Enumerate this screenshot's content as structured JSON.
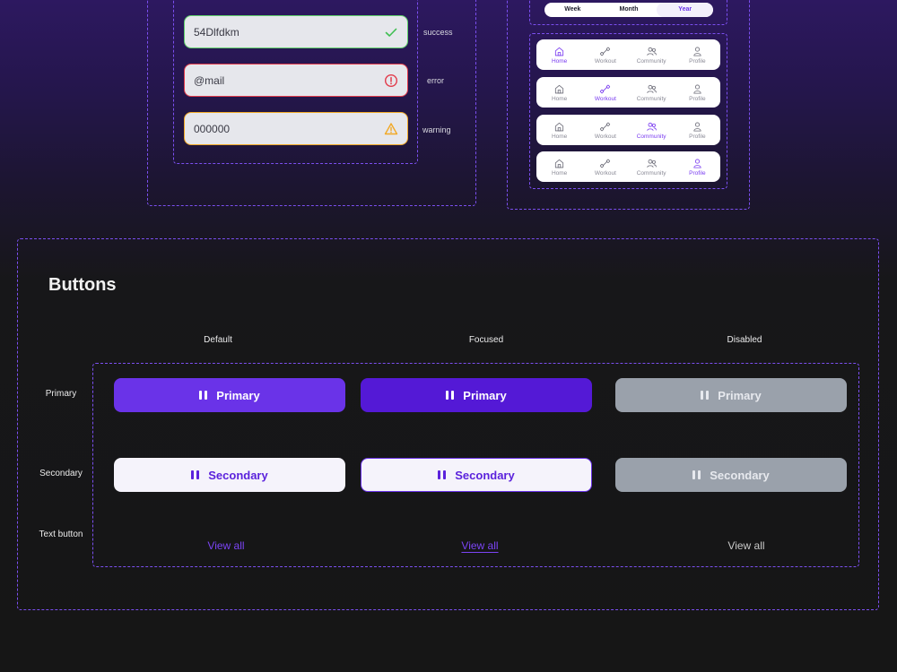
{
  "inputs": [
    {
      "value": "54Dlfdkm",
      "state": "success",
      "border": "#5fd06a",
      "icon": "check-icon"
    },
    {
      "value": "@mail",
      "state": "error",
      "border": "#e23b4b",
      "icon": "error-circle-icon"
    },
    {
      "value": "000000",
      "state": "warning",
      "border": "#f1a927",
      "icon": "warning-triangle-icon"
    }
  ],
  "segment": {
    "options": [
      "Week",
      "Month",
      "Year"
    ],
    "active": "Year"
  },
  "navbars": {
    "items": [
      "Home",
      "Workout",
      "Community",
      "Profile"
    ],
    "active": [
      "Home",
      "Workout",
      "Community",
      "Profile"
    ]
  },
  "buttons": {
    "title": "Buttons",
    "columns": [
      "Default",
      "Focused",
      "Disabled"
    ],
    "rows": [
      "Primary",
      "Secondary",
      "Text button"
    ],
    "primary_label": "Primary",
    "secondary_label": "Secondary",
    "text_label": "View all"
  },
  "colors": {
    "accent": "#6a33e8",
    "accent_focused": "#5419d6",
    "disabled": "#9aa1ab",
    "text_link": "#7b44f5",
    "text_disabled": "#c9c9c9"
  }
}
